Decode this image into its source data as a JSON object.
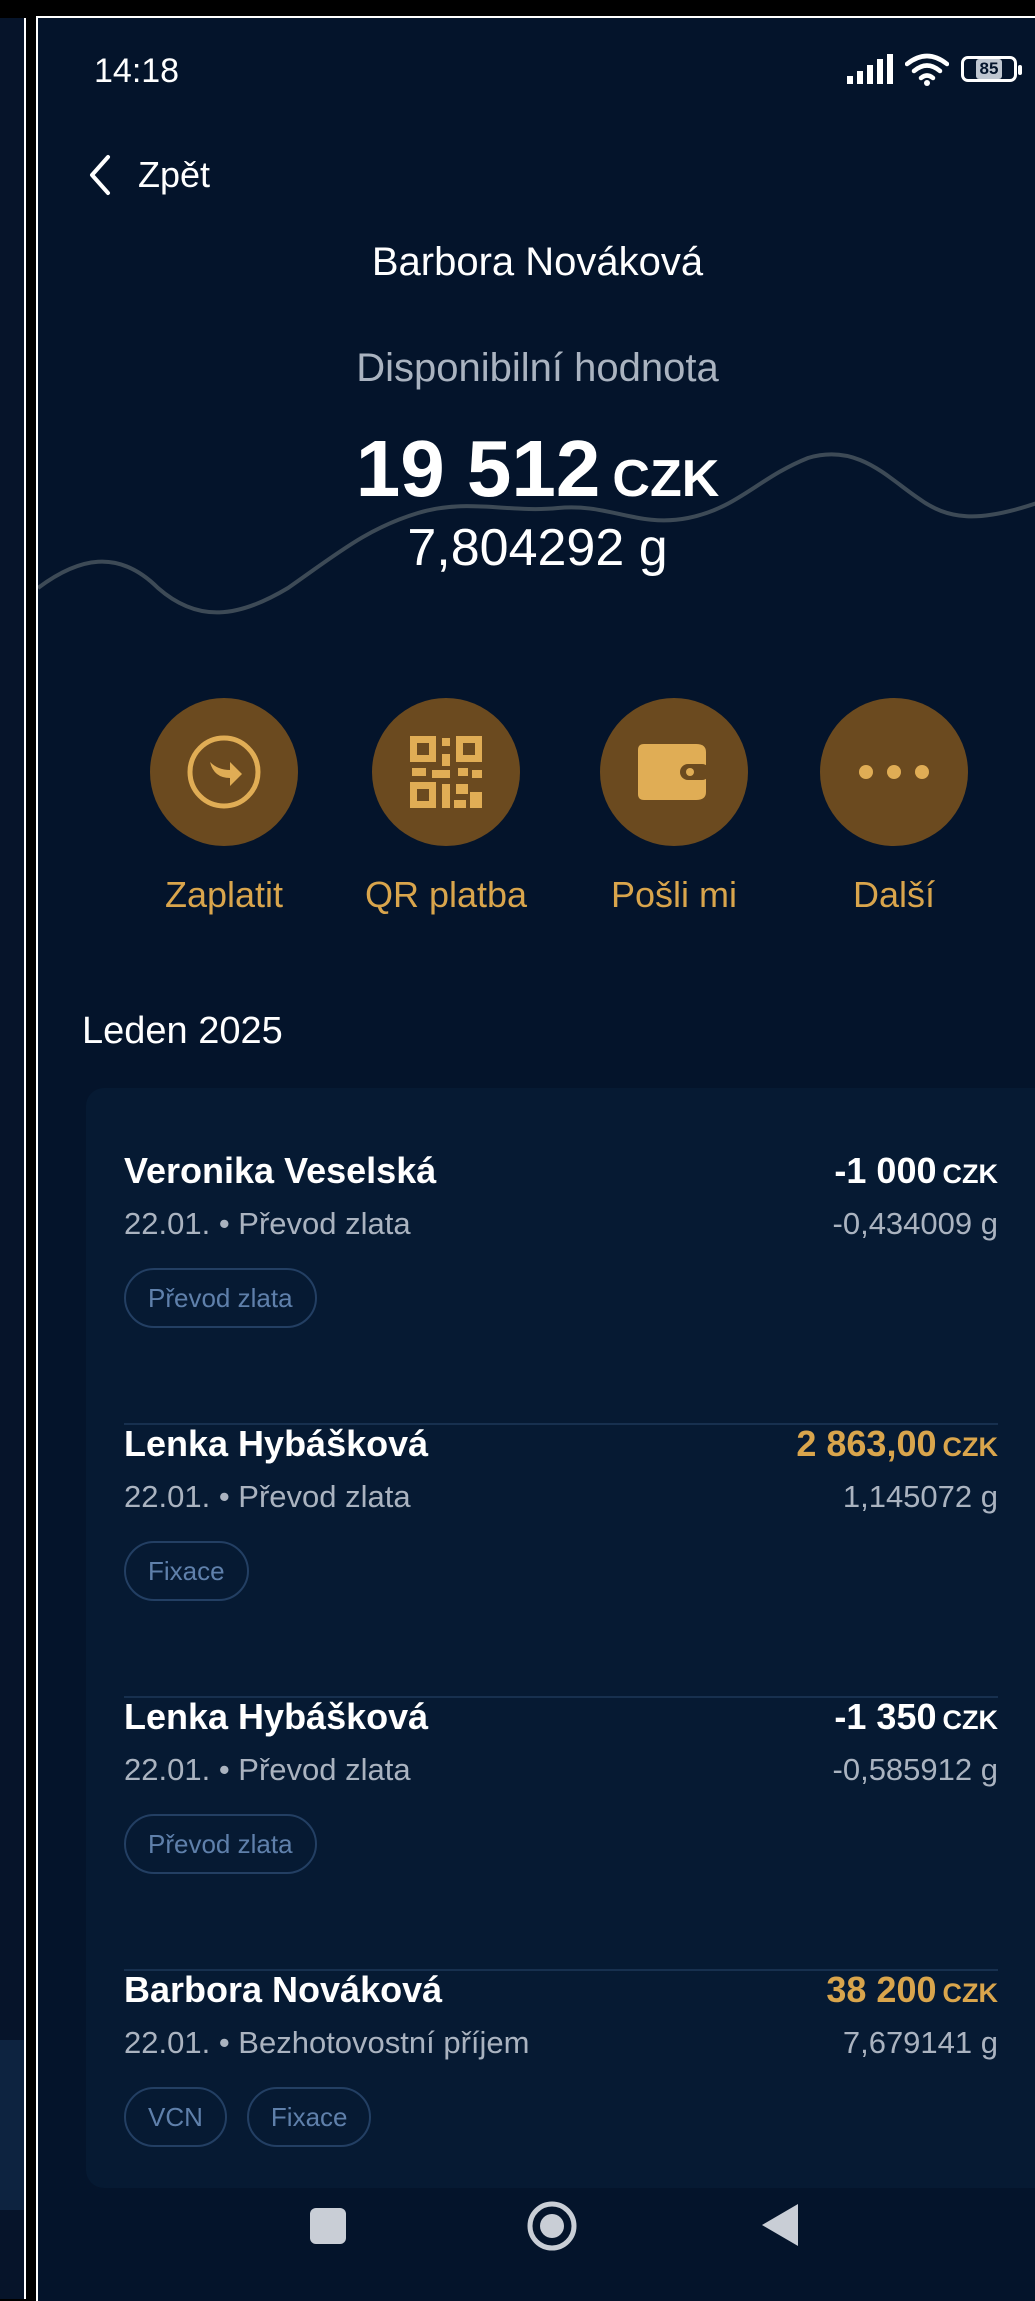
{
  "status": {
    "time": "14:18",
    "battery": "85"
  },
  "header": {
    "back_label": "Zpět",
    "user_name": "Barbora Nováková"
  },
  "balance": {
    "label": "Disponibilní hodnota",
    "amount": "19 512",
    "currency": "CZK",
    "grams": "7,804292 g"
  },
  "actions": [
    {
      "label": "Zaplatit",
      "icon": "arrow-circle-icon"
    },
    {
      "label": "QR platba",
      "icon": "qr-code-icon"
    },
    {
      "label": "Pošli mi",
      "icon": "wallet-icon"
    },
    {
      "label": "Další",
      "icon": "more-icon"
    }
  ],
  "month": "Leden 2025",
  "transactions": [
    {
      "name": "Veronika Veselská",
      "date": "22.01.",
      "type": "Převod zlata",
      "amount": "-1 000",
      "currency": "CZK",
      "grams": "-0,434009 g",
      "tags": [
        "Převod zlata"
      ]
    },
    {
      "name": "Lenka Hybášková",
      "date": "22.01.",
      "type": "Převod zlata",
      "amount": "2 863,00",
      "currency": "CZK",
      "grams": "1,145072 g",
      "tags": [
        "Fixace"
      ]
    },
    {
      "name": "Lenka Hybášková",
      "date": "22.01.",
      "type": "Převod zlata",
      "amount": "-1 350",
      "currency": "CZK",
      "grams": "-0,585912 g",
      "tags": [
        "Převod zlata"
      ]
    },
    {
      "name": "Barbora Nováková",
      "date": "22.01.",
      "type": "Bezhotovostní příjem",
      "amount": "38 200",
      "currency": "CZK",
      "grams": "7,679141 g",
      "tags": [
        "VCN",
        "Fixace"
      ]
    }
  ],
  "colors": {
    "background": "#04142b",
    "accent": "#d9a54c",
    "action_circle": "#6b4a1f",
    "tag_text": "#5f80ab"
  }
}
